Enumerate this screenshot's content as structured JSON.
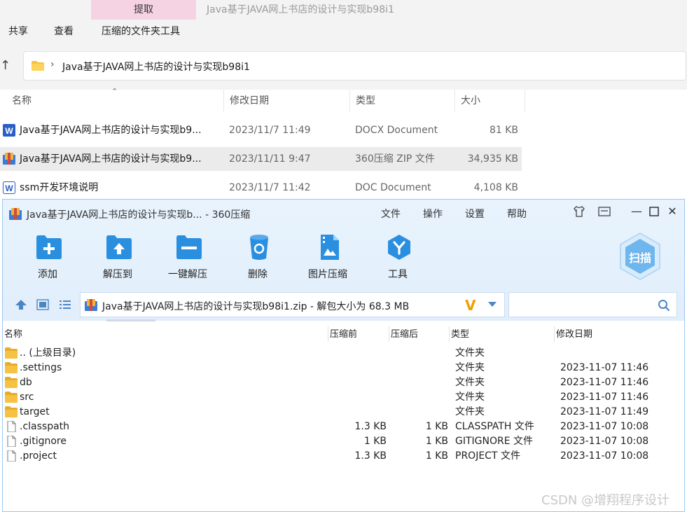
{
  "explorer": {
    "tab_active": "提取",
    "window_title": "Java基于JAVA网上书店的设计与实现b98i1",
    "ribbon": [
      "共享",
      "查看",
      "压缩的文件夹工具"
    ],
    "address": "Java基于JAVA网上书店的设计与实现b98i1",
    "columns": [
      "名称",
      "修改日期",
      "类型",
      "大小"
    ],
    "files": [
      {
        "name": "Java基于JAVA网上书店的设计与实现b9...",
        "date": "2023/11/7 11:49",
        "type": "DOCX Document",
        "size": "81 KB",
        "icon": "word-doc-icon"
      },
      {
        "name": "Java基于JAVA网上书店的设计与实现b9...",
        "date": "2023/11/11 9:47",
        "type": "360压缩 ZIP 文件",
        "size": "34,935 KB",
        "icon": "zip-archive-icon"
      },
      {
        "name": "ssm开发环境说明",
        "date": "2023/11/7 11:42",
        "type": "DOC Document",
        "size": "4,108 KB",
        "icon": "word-doc-icon"
      }
    ]
  },
  "zip": {
    "title": "Java基于JAVA网上书店的设计与实现b... - 360压缩",
    "menu": [
      "文件",
      "操作",
      "设置",
      "帮助"
    ],
    "tools": [
      {
        "label": "添加",
        "icon": "add-icon"
      },
      {
        "label": "解压到",
        "icon": "extract-to-icon"
      },
      {
        "label": "一键解压",
        "icon": "one-click-extract-icon"
      },
      {
        "label": "删除",
        "icon": "recycle-bin-icon"
      },
      {
        "label": "图片压缩",
        "icon": "image-compress-icon"
      },
      {
        "label": "工具",
        "icon": "tools-icon"
      }
    ],
    "scan_label": "扫描",
    "path": "Java基于JAVA网上书店的设计与实现b98i1.zip - 解包大小为 68.3 MB",
    "columns": [
      "名称",
      "压缩前",
      "压缩后",
      "类型",
      "修改日期"
    ],
    "rows": [
      {
        "name": ".. (上级目录)",
        "before": "",
        "after": "",
        "type": "文件夹",
        "date": "",
        "kind": "folder"
      },
      {
        "name": ".settings",
        "before": "",
        "after": "",
        "type": "文件夹",
        "date": "2023-11-07 11:46",
        "kind": "folder"
      },
      {
        "name": "db",
        "before": "",
        "after": "",
        "type": "文件夹",
        "date": "2023-11-07 11:46",
        "kind": "folder"
      },
      {
        "name": "src",
        "before": "",
        "after": "",
        "type": "文件夹",
        "date": "2023-11-07 11:46",
        "kind": "folder"
      },
      {
        "name": "target",
        "before": "",
        "after": "",
        "type": "文件夹",
        "date": "2023-11-07 11:49",
        "kind": "folder"
      },
      {
        "name": ".classpath",
        "before": "1.3 KB",
        "after": "1 KB",
        "type": "CLASSPATH 文件",
        "date": "2023-11-07 10:08",
        "kind": "file"
      },
      {
        "name": ".gitignore",
        "before": "1 KB",
        "after": "1 KB",
        "type": "GITIGNORE 文件",
        "date": "2023-11-07 10:08",
        "kind": "file"
      },
      {
        "name": ".project",
        "before": "1.3 KB",
        "after": "1 KB",
        "type": "PROJECT 文件",
        "date": "2023-11-07 10:08",
        "kind": "file"
      }
    ]
  },
  "watermark": "CSDN @增翔程序设计",
  "colors": {
    "accent": "#2b8fe0",
    "folder": "#f5c242",
    "zip_header": "#e4f0fc",
    "word": "#2b5fc7"
  }
}
